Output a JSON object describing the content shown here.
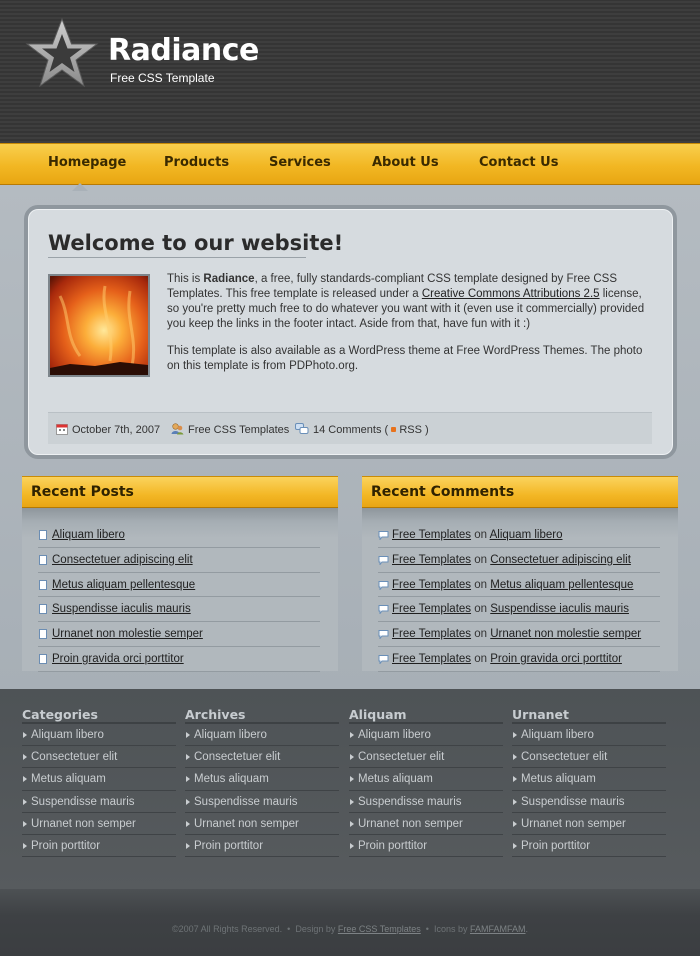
{
  "header": {
    "title": "Radiance",
    "subtitle": "Free CSS Template",
    "logo_icon": "star-icon"
  },
  "menu": {
    "items": [
      {
        "label": "Homepage",
        "active": true
      },
      {
        "label": "Products"
      },
      {
        "label": "Services"
      },
      {
        "label": "About Us"
      },
      {
        "label": "Contact Us"
      }
    ]
  },
  "welcome": {
    "title": "Welcome to our website!",
    "p1_a": "This is ",
    "p1_bold": "Radiance",
    "p1_b": ", a free, fully standards-compliant CSS template designed by Free CSS Templates. This free template is released under a ",
    "p1_link": "Creative Commons Attributions 2.5",
    "p1_c": " license, so you're pretty much free to do whatever you want with it (even use it commercially) provided you keep the links in the footer intact. Aside from that, have fun with it :)",
    "p2": "This template is also available as a WordPress theme at Free WordPress Themes. The photo on this template is from PDPhoto.org.",
    "meta": {
      "date": "October 7th, 2007",
      "author": "Free CSS Templates",
      "comments": "14 Comments",
      "open_paren": "(",
      "rss": "RSS",
      "close_paren": ")"
    }
  },
  "recent_posts": {
    "title": "Recent Posts",
    "items": [
      "Aliquam libero",
      "Consectetuer adipiscing elit",
      "Metus aliquam pellentesque",
      "Suspendisse iaculis mauris",
      "Urnanet non molestie semper",
      "Proin gravida orci porttitor"
    ]
  },
  "recent_comments": {
    "title": "Recent Comments",
    "author": "Free Templates",
    "on": "on",
    "items": [
      "Aliquam libero",
      "Consectetuer adipiscing elit",
      "Metus aliquam pellentesque",
      "Suspendisse iaculis mauris",
      "Urnanet non molestie semper",
      "Proin gravida orci porttitor"
    ]
  },
  "footer_columns": [
    {
      "title": "Categories",
      "items": [
        "Aliquam libero",
        "Consectetuer elit",
        "Metus aliquam",
        "Suspendisse mauris",
        "Urnanet non semper",
        "Proin porttitor"
      ]
    },
    {
      "title": "Archives",
      "items": [
        "Aliquam libero",
        "Consectetuer elit",
        "Metus aliquam",
        "Suspendisse mauris",
        "Urnanet non semper",
        "Proin porttitor"
      ]
    },
    {
      "title": "Aliquam",
      "items": [
        "Aliquam libero",
        "Consectetuer elit",
        "Metus aliquam",
        "Suspendisse mauris",
        "Urnanet non semper",
        "Proin porttitor"
      ]
    },
    {
      "title": "Urnanet",
      "items": [
        "Aliquam libero",
        "Consectetuer elit",
        "Metus aliquam",
        "Suspendisse mauris",
        "Urnanet non semper",
        "Proin porttitor"
      ]
    }
  ],
  "footer": {
    "copyright": "©2007 All Rights Reserved.",
    "sep": "•",
    "design_by": "Design by",
    "design_link": "Free CSS Templates",
    "icons_by": "Icons by",
    "icons_link": "FAMFAMFAM",
    "end": "."
  },
  "colors": {
    "header_bg": "#3b3b3b",
    "menu_accent": "#f2b723",
    "page_bg": "#a9b1b8",
    "footer_bg": "#4e5356"
  }
}
